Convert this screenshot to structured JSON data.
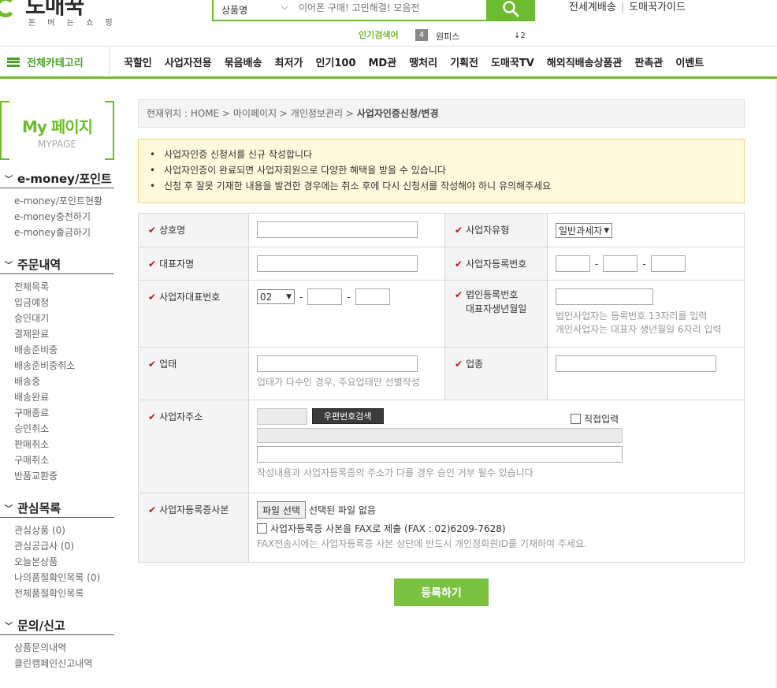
{
  "header": {
    "logo": "도매꾹",
    "logo_tagline": "돈 버 는 쇼 핑",
    "search": {
      "category": "상품명",
      "placeholder": "이어폰 구매! 고민해결! 모음전"
    },
    "top_links": [
      "전세계배송",
      "도매꾹가이드"
    ],
    "popular": {
      "label": "인기검색어",
      "rank": "4",
      "keyword": "원피스",
      "change": "↓2"
    }
  },
  "nav": {
    "all_categories": "전체카테고리",
    "items": [
      "꾹할인",
      "사업자전용",
      "묶음배송",
      "최저가",
      "인기100",
      "MD관",
      "땡처리",
      "기획전",
      "도매꾹TV",
      "해외직배송상품관",
      "판촉관",
      "이벤트"
    ]
  },
  "sidebar": {
    "title": "My 페이지",
    "subtitle": "MYPAGE",
    "sections": [
      {
        "title": "e-money/포인트",
        "items": [
          "e-money/포인트현황",
          "e-money충전하기",
          "e-money출금하기"
        ]
      },
      {
        "title": "주문내역",
        "items": [
          "전체목록",
          "입금예정",
          "승인대기",
          "결제완료",
          "배송준비중",
          "배송준비중취소",
          "배송중",
          "배송완료",
          "구매종료",
          "승인취소",
          "판매취소",
          "구매취소",
          "반품교환중"
        ]
      },
      {
        "title": "관심목록",
        "items": [
          "관심상품 (0)",
          "관심공급사 (0)",
          "오늘본상품",
          "나의품절확인목록 (0)",
          "전체품절확인목록"
        ]
      },
      {
        "title": "문의/신고",
        "items": [
          "상품문의내역",
          "클린캠페인신고내역"
        ]
      }
    ]
  },
  "breadcrumb": {
    "prefix": "현재위치 : HOME > 마이페이지 > 개인정보관리 > ",
    "current": "사업자인증신청/변경"
  },
  "notice": [
    "사업자인증 신청서를 신규 작성합니다",
    "사업자인증이 완료되면 사업자회원으로 다양한 혜택을 받을 수 있습니다",
    "신청 후 잘못 기재한 내용을 발견한 경우에는 취소 후에 다시 신청서를 작성해야 하니 유의해주세요"
  ],
  "form": {
    "company_name": {
      "label": "상호명",
      "value": ""
    },
    "business_type": {
      "label": "사업자유형",
      "selected": "일반과세자"
    },
    "ceo_name": {
      "label": "대표자명",
      "value": ""
    },
    "business_number": {
      "label": "사업자등록번호"
    },
    "phone": {
      "label": "사업자대표번호",
      "area_code": "02"
    },
    "corp_number": {
      "label_line1": "법인등록번호",
      "label_line2": "대표자생년월일",
      "hint_line1": "법인사업자는 등록번호 13자리를 입력",
      "hint_line2": "개인사업자는 대표자 생년월일 6자리 입력"
    },
    "business_condition": {
      "label": "업태",
      "hint": "업태가 다수인 경우, 주요업태만 선별작성"
    },
    "business_item": {
      "label": "업종"
    },
    "address": {
      "label": "사업자주소",
      "zip_button": "우편번호검색",
      "direct_input": "직접입력",
      "hint": "작성내용과 사업자등록증의 주소가 다를 경우 승인 거부 될수 있습니다"
    },
    "certificate": {
      "label": "사업자등록증사본",
      "file_button": "파일 선택",
      "file_status": "선택된 파일 없음",
      "fax_option": "사업자등록증 사본을 FAX로 제출 (FAX : 02)6209-7628)",
      "fax_hint": "FAX전송시에는 사업자등록증 사본 상단에 반드시 개인정회원ID를 기재하여 주세요."
    }
  },
  "submit_label": "등록하기",
  "colors": {
    "accent": "#6dbb2e",
    "required_mark": "#c0171f"
  }
}
